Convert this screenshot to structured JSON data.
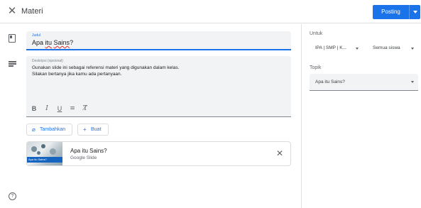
{
  "header": {
    "close_icon": "close-icon",
    "title": "Materi",
    "post_label": "Posting",
    "post_menu_icon": "caret-down-icon",
    "accent": "#1a73e8"
  },
  "form": {
    "title_field": {
      "label": "Judul",
      "value_prefix": "Apa ",
      "value_misspelled": "itu",
      "value_word2": " ",
      "value_misspelled2": "Sains",
      "value_suffix": "?"
    },
    "description_field": {
      "label": "Deskripsi (opsional)",
      "line1": "Gunakan slide ini sebagai referensi materi yang digunakan dalam kelas.",
      "line2": "Silakan bertanya jika kamu ada pertanyaan."
    },
    "format_buttons": [
      "B",
      "I",
      "U",
      "≡",
      "T̸"
    ],
    "add_button": "Tambahkan",
    "create_button": "Buat"
  },
  "attachment": {
    "title": "Apa itu Sains?",
    "subtitle": "Google Slide",
    "thumb_text": "Apa itu Sains?"
  },
  "side": {
    "for_label": "Untuk",
    "class_value": "IPA | SMP | K...",
    "students_value": "Semua siswa",
    "topic_label": "Topik",
    "topic_value": "Apa itu Sains?"
  },
  "help_icon": "help-icon"
}
